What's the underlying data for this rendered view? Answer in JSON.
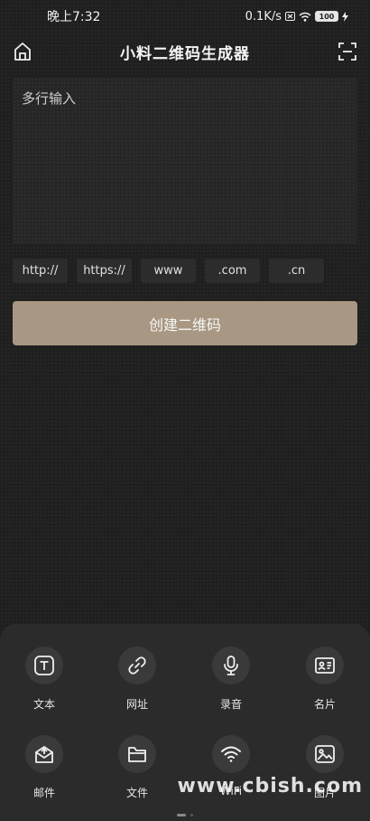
{
  "status_bar": {
    "time": "晚上7:32",
    "network_speed": "0.1K/s",
    "battery_level": "100"
  },
  "app_bar": {
    "title": "小料二维码生成器",
    "left_icon": "home-icon",
    "right_icon": "scan-icon"
  },
  "input": {
    "placeholder": "多行输入",
    "value": ""
  },
  "chips": [
    {
      "label": "http://"
    },
    {
      "label": "https://"
    },
    {
      "label": "www"
    },
    {
      "label": ".com"
    },
    {
      "label": ".cn"
    }
  ],
  "create_button": {
    "label": "创建二维码"
  },
  "tools": [
    {
      "label": "文本",
      "icon": "text-icon"
    },
    {
      "label": "网址",
      "icon": "link-icon"
    },
    {
      "label": "录音",
      "icon": "microphone-icon"
    },
    {
      "label": "名片",
      "icon": "business-card-icon"
    },
    {
      "label": "邮件",
      "icon": "mail-icon"
    },
    {
      "label": "文件",
      "icon": "folder-icon"
    },
    {
      "label": "WiFi",
      "icon": "wifi-icon"
    },
    {
      "label": "图片",
      "icon": "image-icon"
    }
  ],
  "watermark": "www.cbish.com",
  "colors": {
    "background": "#1f1f1f",
    "accent_button": "#a89782",
    "panel": "#2b2b2b"
  }
}
